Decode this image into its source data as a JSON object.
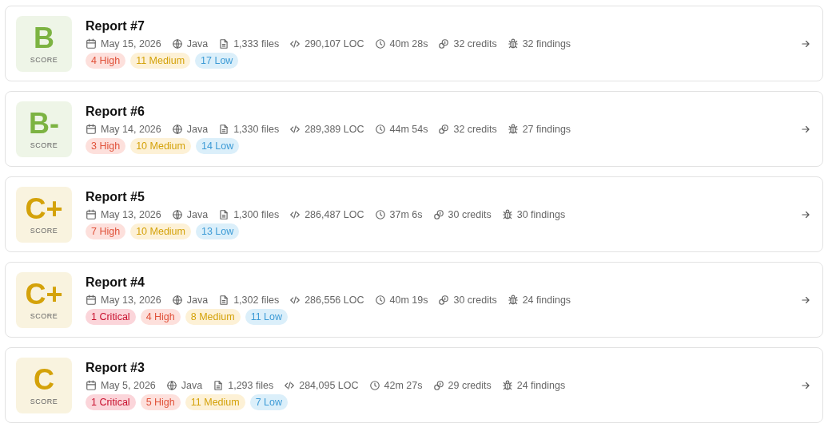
{
  "reports": [
    {
      "grade": "B",
      "grade_label": "SCORE",
      "color": "#7cb342",
      "title": "Report #7",
      "meta": [
        {
          "kind": "date",
          "text": "May 15, 2026"
        },
        {
          "kind": "language",
          "text": "Java"
        },
        {
          "kind": "files",
          "text": "1,333 files"
        },
        {
          "kind": "loc",
          "text": "290,107 LOC"
        },
        {
          "kind": "duration",
          "text": "40m 28s"
        },
        {
          "kind": "credits",
          "text": "32 credits"
        },
        {
          "kind": "findings",
          "text": "32 findings"
        }
      ],
      "badges": [
        {
          "kind": "high",
          "text": "4 High"
        },
        {
          "kind": "medium",
          "text": "11 Medium"
        },
        {
          "kind": "low",
          "text": "17 Low"
        }
      ]
    },
    {
      "grade": "B-",
      "grade_label": "SCORE",
      "color": "#7cb342",
      "title": "Report #6",
      "meta": [
        {
          "kind": "date",
          "text": "May 14, 2026"
        },
        {
          "kind": "language",
          "text": "Java"
        },
        {
          "kind": "files",
          "text": "1,330 files"
        },
        {
          "kind": "loc",
          "text": "289,389 LOC"
        },
        {
          "kind": "duration",
          "text": "44m 54s"
        },
        {
          "kind": "credits",
          "text": "32 credits"
        },
        {
          "kind": "findings",
          "text": "27 findings"
        }
      ],
      "badges": [
        {
          "kind": "high",
          "text": "3 High"
        },
        {
          "kind": "medium",
          "text": "10 Medium"
        },
        {
          "kind": "low",
          "text": "14 Low"
        }
      ]
    },
    {
      "grade": "C+",
      "grade_label": "SCORE",
      "color": "#d4a20a",
      "title": "Report #5",
      "meta": [
        {
          "kind": "date",
          "text": "May 13, 2026"
        },
        {
          "kind": "language",
          "text": "Java"
        },
        {
          "kind": "files",
          "text": "1,300 files"
        },
        {
          "kind": "loc",
          "text": "286,487 LOC"
        },
        {
          "kind": "duration",
          "text": "37m 6s"
        },
        {
          "kind": "credits",
          "text": "30 credits"
        },
        {
          "kind": "findings",
          "text": "30 findings"
        }
      ],
      "badges": [
        {
          "kind": "high",
          "text": "7 High"
        },
        {
          "kind": "medium",
          "text": "10 Medium"
        },
        {
          "kind": "low",
          "text": "13 Low"
        }
      ]
    },
    {
      "grade": "C+",
      "grade_label": "SCORE",
      "color": "#d4a20a",
      "title": "Report #4",
      "meta": [
        {
          "kind": "date",
          "text": "May 13, 2026"
        },
        {
          "kind": "language",
          "text": "Java"
        },
        {
          "kind": "files",
          "text": "1,302 files"
        },
        {
          "kind": "loc",
          "text": "286,556 LOC"
        },
        {
          "kind": "duration",
          "text": "40m 19s"
        },
        {
          "kind": "credits",
          "text": "30 credits"
        },
        {
          "kind": "findings",
          "text": "24 findings"
        }
      ],
      "badges": [
        {
          "kind": "critical",
          "text": "1 Critical"
        },
        {
          "kind": "high",
          "text": "4 High"
        },
        {
          "kind": "medium",
          "text": "8 Medium"
        },
        {
          "kind": "low",
          "text": "11 Low"
        }
      ]
    },
    {
      "grade": "C",
      "grade_label": "SCORE",
      "color": "#d4a20a",
      "title": "Report #3",
      "meta": [
        {
          "kind": "date",
          "text": "May 5, 2026"
        },
        {
          "kind": "language",
          "text": "Java"
        },
        {
          "kind": "files",
          "text": "1,293 files"
        },
        {
          "kind": "loc",
          "text": "284,095 LOC"
        },
        {
          "kind": "duration",
          "text": "42m 27s"
        },
        {
          "kind": "credits",
          "text": "29 credits"
        },
        {
          "kind": "findings",
          "text": "24 findings"
        }
      ],
      "badges": [
        {
          "kind": "critical",
          "text": "1 Critical"
        },
        {
          "kind": "high",
          "text": "5 High"
        },
        {
          "kind": "medium",
          "text": "11 Medium"
        },
        {
          "kind": "low",
          "text": "7 Low"
        }
      ]
    }
  ]
}
